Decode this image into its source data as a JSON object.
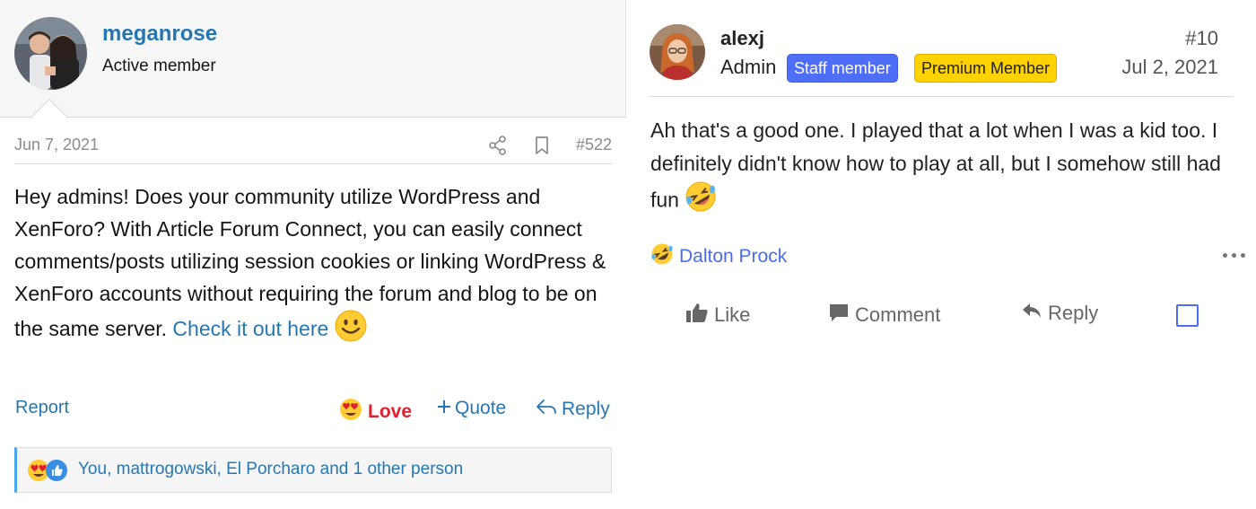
{
  "left_post": {
    "username": "meganrose",
    "user_title": "Active member",
    "date": "Jun 7, 2021",
    "post_number": "#522",
    "body_text": "Hey admins! Does your community utilize WordPress and XenForo? With Article Forum Connect, you can easily connect comments/posts utilizing session cookies or linking WordPress & XenForo accounts without requiring the forum and blog to be on the same server. ",
    "body_link": "Check it out here",
    "actions": {
      "report": "Report",
      "love": "Love",
      "quote": "Quote",
      "reply": "Reply"
    },
    "reactions_summary": "You, mattrogowski, El Porcharo and 1 other person",
    "icons": [
      "share-icon",
      "bookmark-icon",
      "smile-emoji",
      "heart-eyes-emoji",
      "thumbs-up-icon",
      "plus-icon",
      "reply-arrow-icon"
    ]
  },
  "right_post": {
    "username": "alexj",
    "role": "Admin",
    "badges": [
      "Staff member",
      "Premium Member"
    ],
    "post_number": "#10",
    "date": "Jul 2, 2021",
    "body_text": "Ah that's a good one. I played that a lot when I was a kid too. I definitely didn't know how to play at all, but I somehow still had fun",
    "reactor": "Dalton Prock",
    "actions": {
      "like": "Like",
      "comment": "Comment",
      "reply": "Reply"
    },
    "colors": {
      "staff_badge": "#4f6ef7",
      "premium_badge": "#ffd200",
      "link": "#4a6cf0"
    },
    "icons": [
      "rofl-emoji",
      "more-dots-icon",
      "thumbs-up-icon",
      "comment-icon",
      "reply-icon",
      "checkbox-icon"
    ]
  }
}
